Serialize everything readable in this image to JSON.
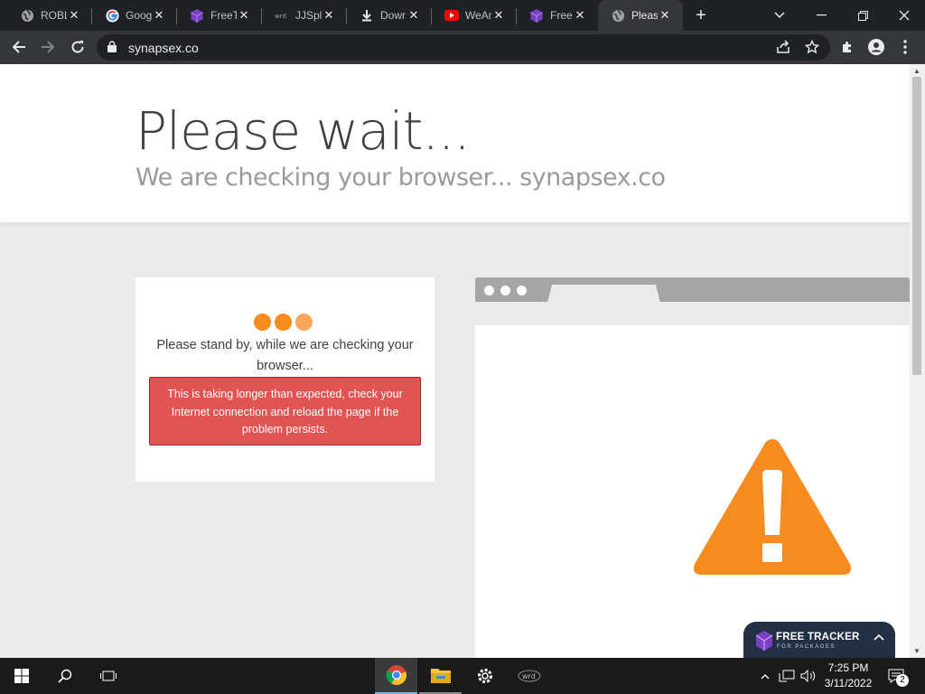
{
  "browser": {
    "tabs": [
      {
        "title": "ROBL",
        "icon": "globe-icon"
      },
      {
        "title": "Goog",
        "icon": "google-icon"
      },
      {
        "title": "FreeT",
        "icon": "package-icon"
      },
      {
        "title": "JJSplo",
        "icon": "jjsploit-icon"
      },
      {
        "title": "Dowr",
        "icon": "download-icon"
      },
      {
        "title": "WeAr",
        "icon": "youtube-icon"
      },
      {
        "title": "FreeT",
        "icon": "package-icon"
      },
      {
        "title": "Pleas",
        "icon": "globe-icon",
        "active": true
      }
    ],
    "url": "synapsex.co"
  },
  "page": {
    "heading": "Please wait...",
    "subheading": "We are checking your browser... synapsex.co",
    "standby_text": "Please stand by, while we are checking your browser...",
    "alert_text": "This is taking longer than expected, check your Internet connection and reload the page if the problem persists.",
    "colors": {
      "accent_orange": "#f68b1f",
      "alert_red": "#e05454"
    }
  },
  "extension_widget": {
    "title": "FREE TRACKER",
    "subtitle": "FOR PACKAGES"
  },
  "taskbar": {
    "apps": [
      "chrome-icon",
      "file-explorer-icon",
      "settings-icon",
      "wrd-app-icon"
    ],
    "time": "7:25 PM",
    "date": "3/11/2022",
    "notification_count": "2"
  }
}
